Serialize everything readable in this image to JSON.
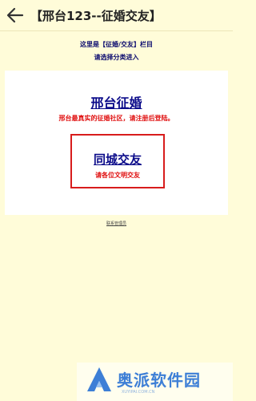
{
  "header": {
    "title": "【邢台123--征婚交友】"
  },
  "intro": {
    "line1": "这里是【征婚/交友】栏目",
    "line2": "请选择分类进入"
  },
  "sections": [
    {
      "title": "邢台征婚",
      "description": "邢台最真实的征婚社区，请注册后登陆。"
    },
    {
      "title": "同城交友",
      "description": "请各位文明交友"
    }
  ],
  "footer": {
    "link": "联系管理员"
  },
  "watermark": {
    "text": "奥派软件园",
    "sub": "XUYIPAI.COM.CN"
  },
  "colors": {
    "background": "#fffcd9",
    "link": "#0c0c8a",
    "highlight": "#e01010",
    "watermark": "#3d7fd6"
  },
  "icons": {
    "back": "arrow-left-icon",
    "watermark_logo": "brand-logo-icon"
  }
}
